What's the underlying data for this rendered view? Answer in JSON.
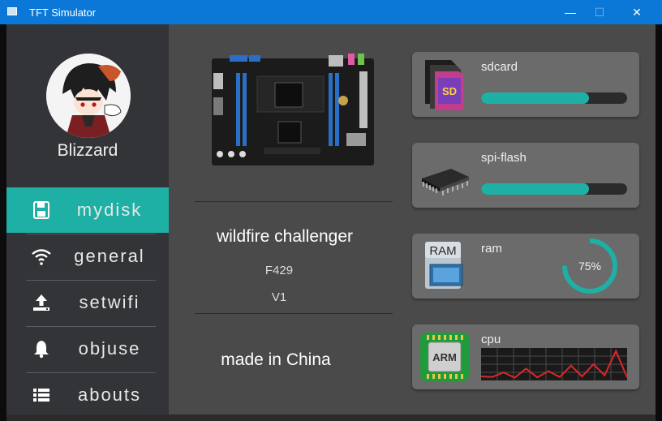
{
  "window": {
    "title": "TFT Simulator",
    "minimize_glyph": "—",
    "maximize_glyph": "☐",
    "close_glyph": "✕"
  },
  "user": {
    "name": "Blizzard"
  },
  "nav": [
    {
      "label": "mydisk",
      "icon": "floppy-disk-icon",
      "active": true
    },
    {
      "label": "general",
      "icon": "wifi-icon",
      "active": false
    },
    {
      "label": "setwifi",
      "icon": "upload-icon",
      "active": false
    },
    {
      "label": "objuse",
      "icon": "bell-icon",
      "active": false
    },
    {
      "label": "abouts",
      "icon": "list-icon",
      "active": false
    }
  ],
  "board": {
    "name": "wildfire challenger",
    "model": "F429",
    "version": "V1",
    "made": "made in China",
    "image": "circuit-board-image"
  },
  "resources": {
    "sdcard": {
      "label": "sdcard",
      "icon": "sd-card-icon",
      "usage": 0.74
    },
    "spiflash": {
      "label": "spi-flash",
      "icon": "memory-chip-icon",
      "usage": 0.74
    },
    "ram": {
      "label": "ram",
      "icon": "ram-icon",
      "percent": 75,
      "percent_text": "75%"
    },
    "cpu": {
      "label": "cpu",
      "icon": "arm-chip-icon",
      "chip_text": "ARM",
      "history": [
        0.08,
        0.06,
        0.22,
        0.04,
        0.35,
        0.05,
        0.26,
        0.06,
        0.45,
        0.08,
        0.5,
        0.12,
        0.95,
        0.05
      ]
    }
  },
  "colors": {
    "accent": "#1eb0a4",
    "sidebar": "#333437",
    "panel": "#4a4a4a",
    "card": "#6b6b6b",
    "titlebar": "#0b78d8",
    "cpu_line": "#e0262a"
  }
}
